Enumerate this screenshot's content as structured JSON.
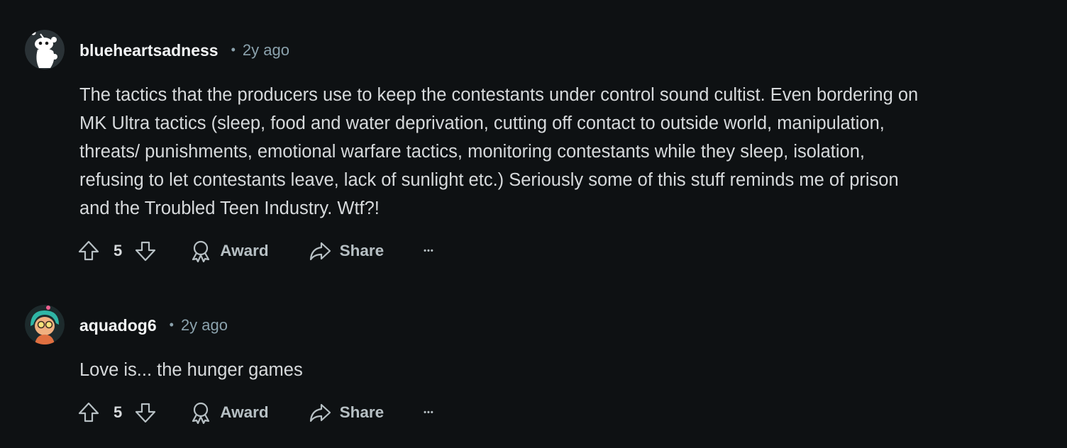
{
  "comments": [
    {
      "username": "blueheartsadness",
      "separator": "•",
      "time": "2y ago",
      "avatar_icon": "snoo-default-avatar",
      "body_lines": [
        "The tactics that the producers use to keep the contestants under control sound cultist. Even bordering on",
        "MK Ultra tactics (sleep, food and water deprivation, cutting off contact to outside world, manipulation,",
        "threats/ punishments, emotional warfare tactics, monitoring contestants while they sleep, isolation,",
        "refusing to let contestants leave, lack of sunlight etc.) Seriously some of this stuff reminds me of prison",
        "and the Troubled Teen Industry. Wtf?!"
      ],
      "votes": "5",
      "award_label": "Award",
      "share_label": "Share",
      "more_label": "•••"
    },
    {
      "username": "aquadog6",
      "separator": "•",
      "time": "2y ago",
      "avatar_icon": "cartoon-character-avatar",
      "body_lines": [
        "Love is... the hunger games"
      ],
      "votes": "5",
      "award_label": "Award",
      "share_label": "Share",
      "more_label": "•••"
    }
  ],
  "colors": {
    "background": "#0e1113",
    "username": "#f2f4f5",
    "meta": "#8ba2ad",
    "body": "#d7dadc",
    "action": "#b7c0c4"
  }
}
